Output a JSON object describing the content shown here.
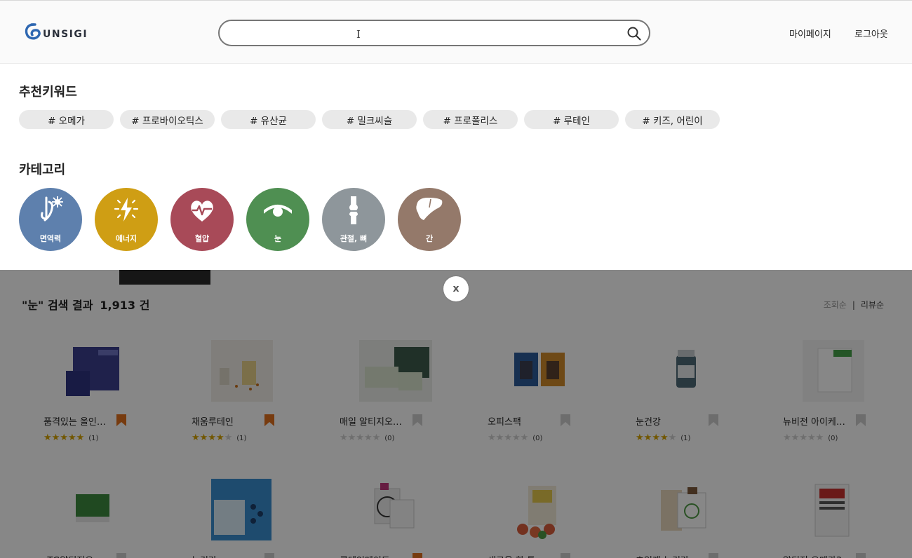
{
  "header": {
    "logo_text": "UNSIGI",
    "search": {
      "value": "",
      "placeholder": ""
    },
    "nav": {
      "mypage": "마이페이지",
      "logout": "로그아웃"
    }
  },
  "panel": {
    "keywords_title": "추천키워드",
    "keywords": [
      "# 오메가",
      "# 프로바이오틱스",
      "# 유산균",
      "# 밀크씨슬",
      "# 프로폴리스",
      "# 루테인",
      "# 키즈, 어린이"
    ],
    "categories_title": "카테고리",
    "categories": [
      {
        "label": "면역력",
        "color": "#5e80ad",
        "icon": "immune-icon"
      },
      {
        "label": "에너지",
        "color": "#cf9e14",
        "icon": "lightning-icon"
      },
      {
        "label": "혈압",
        "color": "#a84a58",
        "icon": "heartbeat-icon"
      },
      {
        "label": "눈",
        "color": "#4f8f52",
        "icon": "eye-icon"
      },
      {
        "label": "관절, 뼈",
        "color": "#8e969b",
        "icon": "bone-joint-icon"
      },
      {
        "label": "간",
        "color": "#94796a",
        "icon": "liver-icon"
      }
    ]
  },
  "close_label": "x",
  "results": {
    "query_label": "\"눈\" 검색 결과",
    "count_label": "1,913 건",
    "sort": {
      "views": "조회순",
      "separator": "|",
      "reviews": "리뷰순"
    },
    "products": [
      {
        "name": "품격있는 올인…",
        "rating": 5,
        "reviews": "(1)",
        "bookmarked": true
      },
      {
        "name": "채움루테인",
        "rating": 4,
        "reviews": "(1)",
        "bookmarked": true
      },
      {
        "name": "매일 알티지오…",
        "rating": 0,
        "reviews": "(0)",
        "bookmarked": false
      },
      {
        "name": "오피스팩",
        "rating": 0,
        "reviews": "(0)",
        "bookmarked": false
      },
      {
        "name": "눈건강",
        "rating": 4,
        "reviews": "(1)",
        "bookmarked": false
      },
      {
        "name": "뉴비전 아이케…",
        "rating": 0,
        "reviews": "(0)",
        "bookmarked": false
      },
      {
        "name": "rTG알티지오…",
        "rating": 0,
        "reviews": "",
        "bookmarked": false
      },
      {
        "name": "눈건강",
        "rating": 0,
        "reviews": "",
        "bookmarked": false
      },
      {
        "name": "루테인메이트",
        "rating": 0,
        "reviews": "",
        "bookmarked": true
      },
      {
        "name": "새로운 한 통",
        "rating": 0,
        "reviews": "",
        "bookmarked": false
      },
      {
        "name": "초임계 눈건강",
        "rating": 0,
        "reviews": "",
        "bookmarked": false
      },
      {
        "name": "알티지 오메가3",
        "rating": 0,
        "reviews": "",
        "bookmarked": false
      }
    ]
  },
  "colors": {
    "bookmark_on": "#e0701e",
    "bookmark_off": "#cfcfcf",
    "star_on": "#d6a300",
    "star_off": "#d0d0d0"
  }
}
